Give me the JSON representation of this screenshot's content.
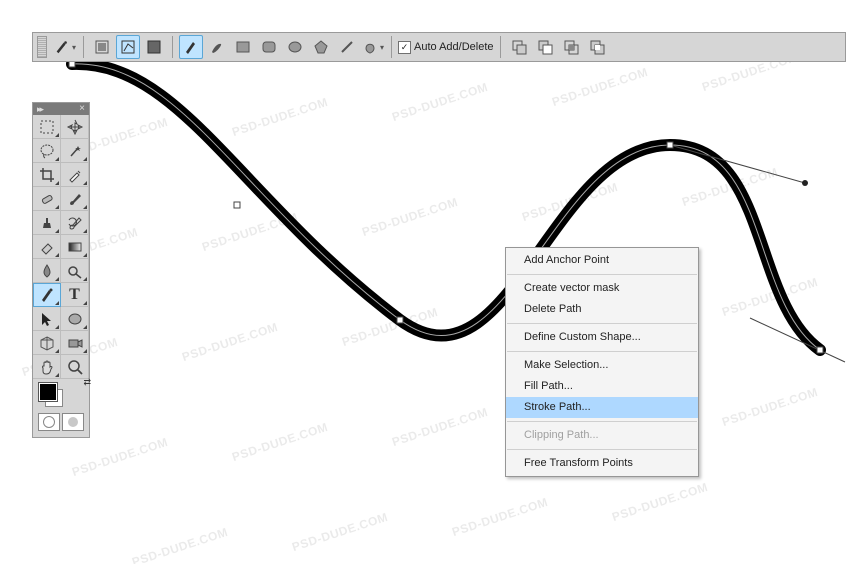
{
  "options_bar": {
    "auto_add_delete_label": "Auto Add/Delete",
    "auto_add_delete_checked": true
  },
  "tools_panel": {
    "selected_tool": "pen-tool"
  },
  "context_menu": {
    "items": {
      "add_anchor": "Add Anchor Point",
      "create_mask": "Create vector mask",
      "delete_path": "Delete Path",
      "define_shape": "Define Custom Shape...",
      "make_selection": "Make Selection...",
      "fill_path": "Fill Path...",
      "stroke_path": "Stroke Path...",
      "clipping_path": "Clipping Path...",
      "free_transform": "Free Transform Points"
    },
    "highlighted": "stroke_path",
    "disabled": "clipping_path"
  },
  "watermark": "PSD-DUDE.COM"
}
